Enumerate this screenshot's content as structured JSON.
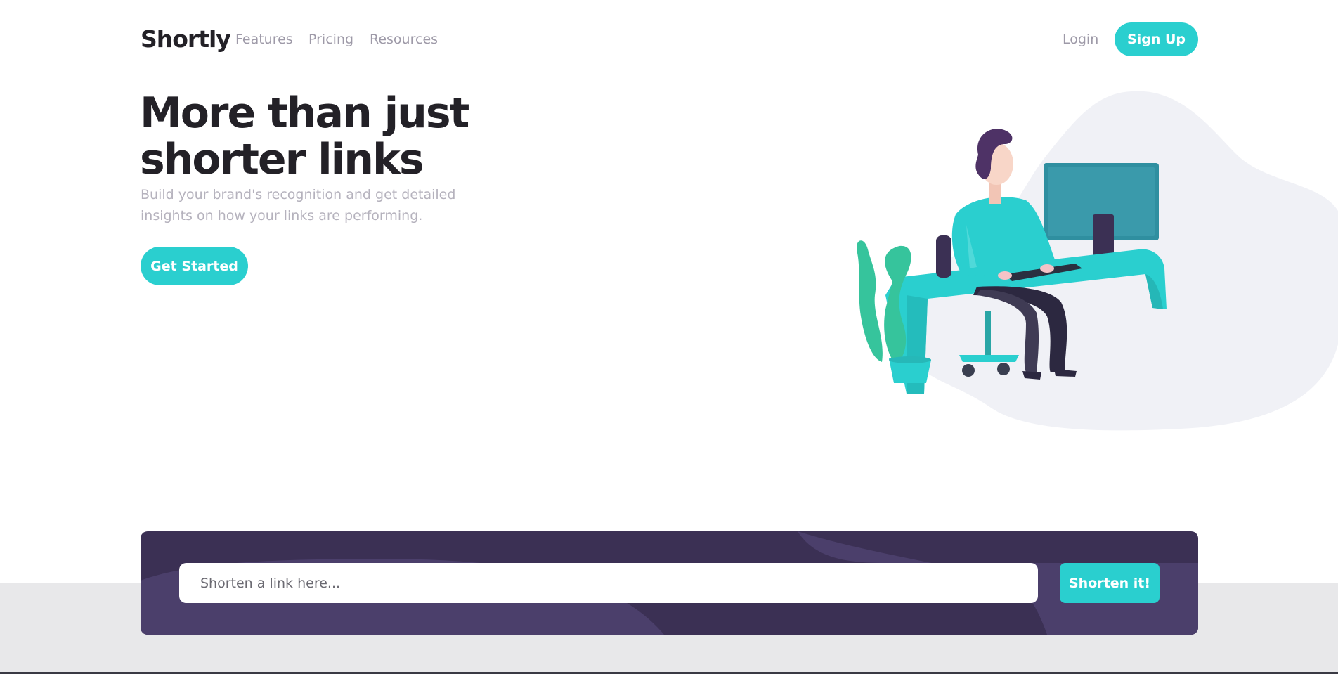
{
  "brand": {
    "name": "Shortly"
  },
  "nav": {
    "features": "Features",
    "pricing": "Pricing",
    "resources": "Resources",
    "login": "Login",
    "signup": "Sign Up"
  },
  "hero": {
    "title": "More than just shorter links",
    "subtitle": "Build your brand's recognition and get detailed insights on how your links are performing.",
    "cta": "Get Started"
  },
  "shorten": {
    "placeholder": "Shorten a link here...",
    "button": "Shorten it!"
  },
  "colors": {
    "primary": "#2acfcf",
    "dark_violet": "#3b3054",
    "heading": "#232127",
    "gray_text": "#9e9aa8",
    "band_gray": "#e8e8ea"
  },
  "icons": {
    "illustration": "person-working-at-desk-illustration"
  }
}
